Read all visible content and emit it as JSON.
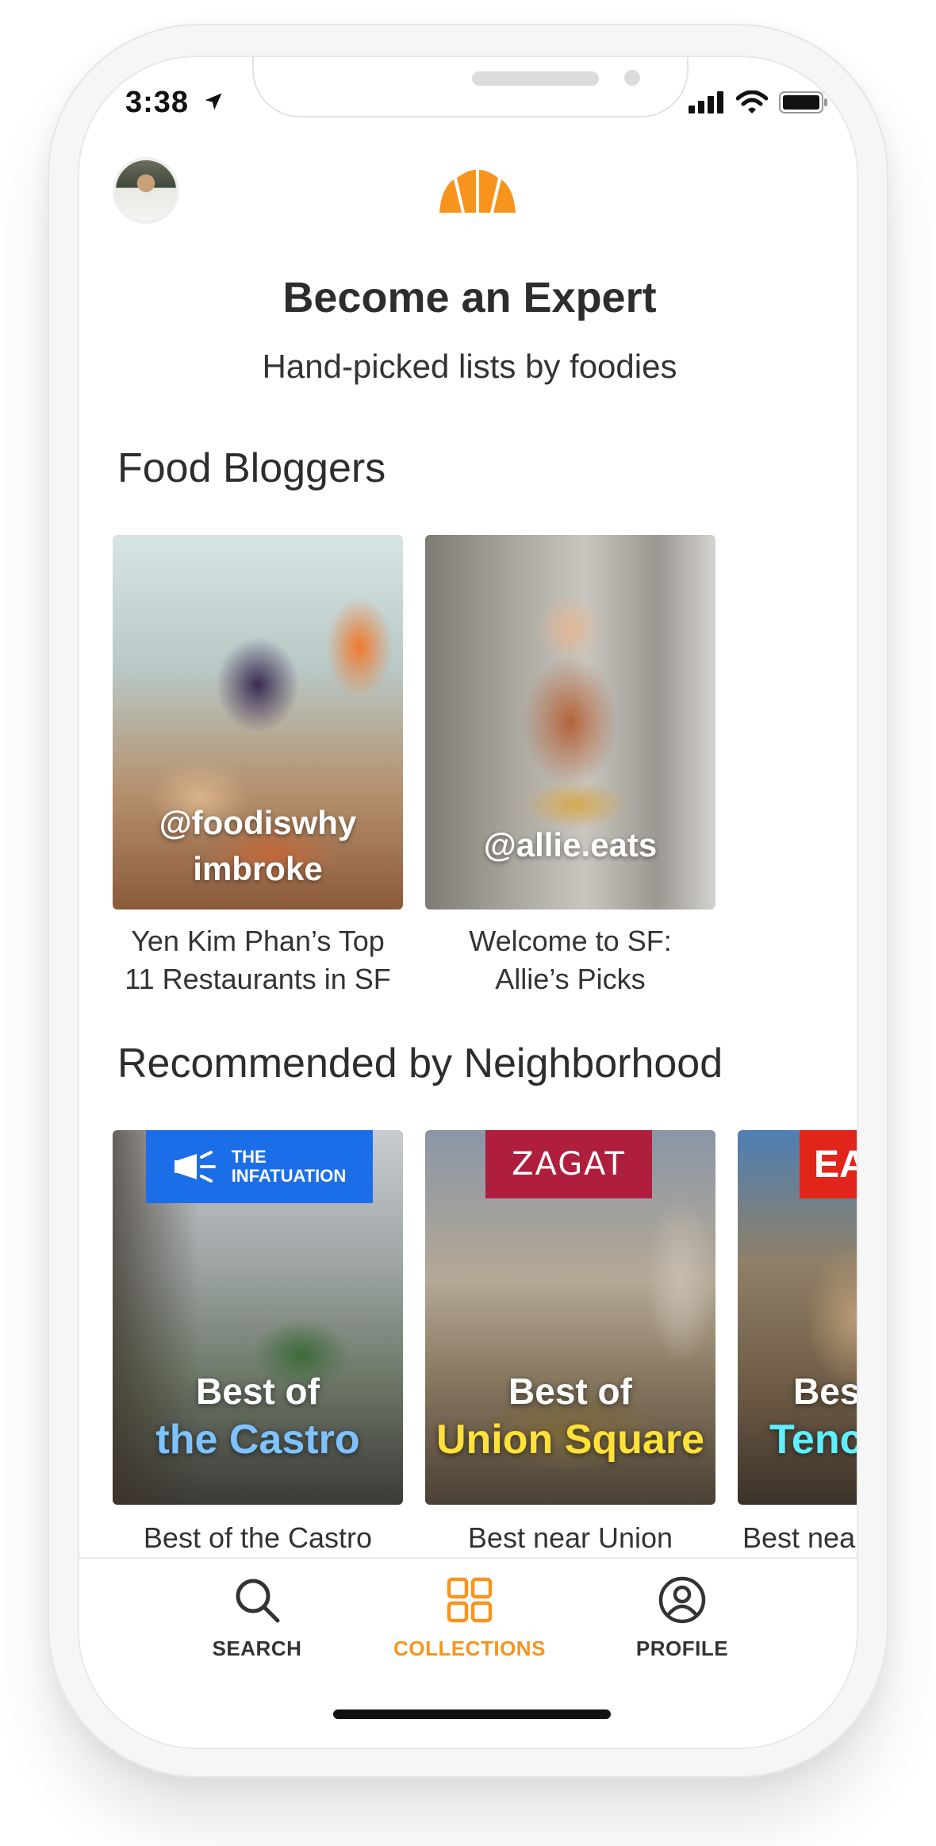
{
  "status_bar": {
    "time": "3:38"
  },
  "header": {
    "title": "Become an Expert",
    "subtitle": "Hand-picked lists by foodies"
  },
  "food_bloggers": {
    "heading": "Food Bloggers",
    "cards": [
      {
        "handle_line1": "@foodiswhy",
        "handle_line2": "imbroke",
        "caption_line1": "Yen Kim Phan’s Top",
        "caption_line2": "11 Restaurants in SF"
      },
      {
        "handle": "@allie.eats",
        "caption_line1": "Welcome to SF:",
        "caption_line2": "Allie’s Picks"
      }
    ]
  },
  "neighborhoods": {
    "heading": "Recommended by Neighborhood",
    "cards": [
      {
        "source": "THE INFATUATION",
        "source_line1": "THE",
        "source_line2": "INFATUATION",
        "top": "Best of",
        "name": "the Castro",
        "name_color": "#7ec3ff",
        "caption": "Best of the Castro"
      },
      {
        "source": "ZAGAT",
        "top": "Best of",
        "name": "Union Square",
        "name_color": "#ffe13a",
        "caption": "Best near Union"
      },
      {
        "source": "EA",
        "top": "Best",
        "name": "Tenc",
        "name_color": "#5ef0ff",
        "caption": "Best near"
      }
    ]
  },
  "tab_bar": {
    "tabs": [
      {
        "label": "SEARCH",
        "icon": "search-icon",
        "active": false
      },
      {
        "label": "COLLECTIONS",
        "icon": "collections-grid-icon",
        "active": true
      },
      {
        "label": "PROFILE",
        "icon": "profile-icon",
        "active": false
      }
    ],
    "active_color": "#f7941d",
    "inactive_color": "#333333"
  },
  "brand": {
    "accent": "#f7941d"
  }
}
